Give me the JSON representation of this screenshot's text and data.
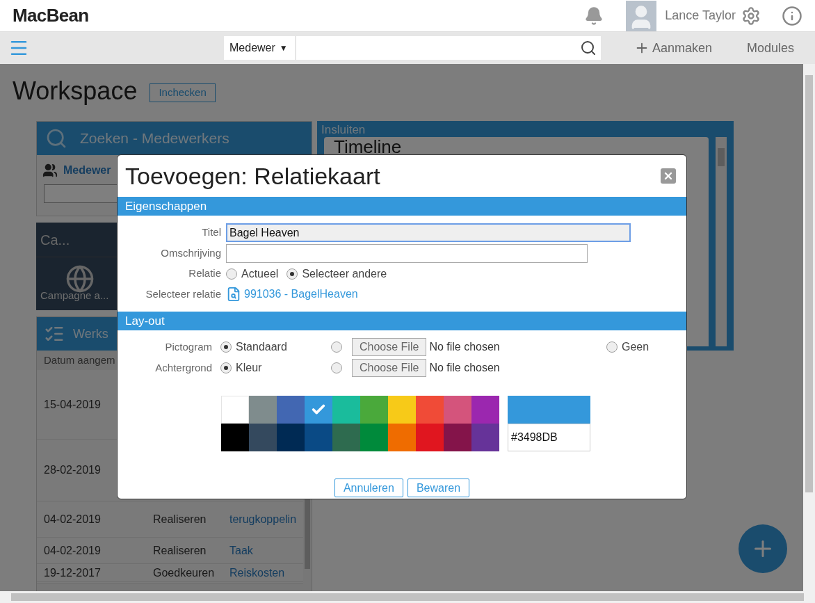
{
  "header": {
    "logo": "MacBean",
    "user": "Lance Taylor"
  },
  "toolbar": {
    "search_scope": "Medewer",
    "search_caret": "▼",
    "create": "Aanmaken",
    "modules": "Modules"
  },
  "workspace": {
    "title": "Workspace",
    "checkin": "Inchecken"
  },
  "search_panel": {
    "title": "Zoeken - Medewerkers",
    "label": "Medewer"
  },
  "campaign_panel": {
    "title": "Ca...",
    "item": "Campagne a..."
  },
  "work_panel": {
    "title": "Werks",
    "columns": [
      "Datum aangem"
    ],
    "rows": [
      {
        "date": "15-04-2019"
      },
      {
        "date": "28-02-2019"
      },
      {
        "date": "04-02-2019",
        "action": "Realiseren",
        "item": "terugkoppelin"
      },
      {
        "date": "04-02-2019",
        "action": "Realiseren",
        "item": "Taak"
      },
      {
        "date": "19-12-2017",
        "action": "Goedkeuren",
        "item": "Reiskosten"
      }
    ]
  },
  "embed_panel": {
    "title": "Insluiten",
    "card_title": "Timeline"
  },
  "dialog": {
    "title": "Toevoegen: Relatiekaart",
    "section_properties": "Eigenschappen",
    "title_label": "Titel",
    "title_value": "Bagel Heaven",
    "description_label": "Omschrijving",
    "relation_label": "Relatie",
    "relation_options": [
      {
        "label": "Actueel",
        "selected": false
      },
      {
        "label": "Selecteer andere",
        "selected": true
      }
    ],
    "select_relation_label": "Selecteer relatie",
    "select_relation_link": "991036 - BagelHeaven",
    "section_layout": "Lay-out",
    "layout_rows": [
      {
        "label": "Pictogram",
        "options": [
          {
            "kind": "radio",
            "label": "Standaard",
            "selected": true
          },
          {
            "kind": "file",
            "button": "Choose File",
            "status": "No file chosen",
            "selected": false
          },
          {
            "kind": "radio",
            "label": "Geen",
            "selected": false
          }
        ]
      },
      {
        "label": "Achtergrond",
        "options": [
          {
            "kind": "radio",
            "label": "Kleur",
            "selected": true
          },
          {
            "kind": "file",
            "button": "Choose File",
            "status": "No file chosen",
            "selected": false
          }
        ]
      }
    ],
    "swatches": [
      {
        "color": "#ffffff",
        "selected": false
      },
      {
        "color": "#7f8c8d",
        "selected": false
      },
      {
        "color": "#4267b2",
        "selected": false
      },
      {
        "color": "#3498db",
        "selected": true
      },
      {
        "color": "#1abc9c",
        "selected": false
      },
      {
        "color": "#4aa93b",
        "selected": false
      },
      {
        "color": "#f7ca18",
        "selected": false
      },
      {
        "color": "#f04b37",
        "selected": false
      },
      {
        "color": "#d4547c",
        "selected": false
      },
      {
        "color": "#9b27af",
        "selected": false
      },
      {
        "color": "#000000",
        "selected": false
      },
      {
        "color": "#34495e",
        "selected": false
      },
      {
        "color": "#002a54",
        "selected": false
      },
      {
        "color": "#0a4a85",
        "selected": false
      },
      {
        "color": "#2e6b4f",
        "selected": false
      },
      {
        "color": "#008a3b",
        "selected": false
      },
      {
        "color": "#ef6c00",
        "selected": false
      },
      {
        "color": "#e0161f",
        "selected": false
      },
      {
        "color": "#84144a",
        "selected": false
      },
      {
        "color": "#663399",
        "selected": false
      }
    ],
    "hex_value": "#3498DB",
    "buttons": [
      "Annuleren",
      "Bewaren"
    ]
  }
}
